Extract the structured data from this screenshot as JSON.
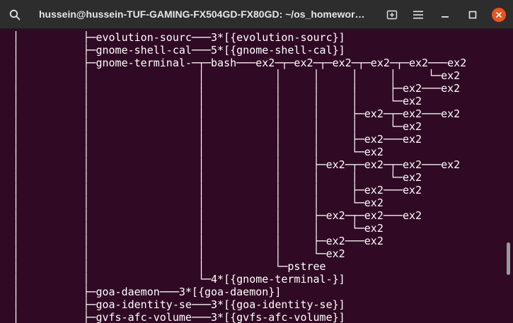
{
  "window": {
    "title": "hussein@hussein-TUF-GAMING-FX504GD-FX80GD: ~/os_homewor…",
    "buttons": {
      "search": "search-icon",
      "new_tab": "new-tab-icon",
      "menu": "hamburger-menu-icon",
      "minimize": "minimize-icon",
      "maximize": "maximize-icon",
      "close": "close-icon"
    },
    "colors": {
      "background": "#300a24",
      "titlebar": "#2d2d2d",
      "text": "#ffffff",
      "close_button": "#e95420"
    }
  },
  "terminal": {
    "lines": [
      "  │          ├─evolution-sourc───3*[{evolution-sourc}]",
      "  │          ├─gnome-shell-cal───5*[{gnome-shell-cal}]",
      "  │          ├─gnome-terminal-─┬─bash───ex2─┬─ex2─┬─ex2─┬─ex2─┬─ex2───ex2",
      "  │          │                 │           │     │     │     │     └─ex2",
      "  │          │                 │           │     │     │     ├─ex2───ex2",
      "  │          │                 │           │     │     │     └─ex2",
      "  │          │                 │           │     │     ├─ex2─┬─ex2───ex2",
      "  │          │                 │           │     │     │     └─ex2",
      "  │          │                 │           │     │     ├─ex2───ex2",
      "  │          │                 │           │     │     └─ex2",
      "  │          │                 │           │     ├─ex2─┬─ex2─┬─ex2───ex2",
      "  │          │                 │           │     │     │     └─ex2",
      "  │          │                 │           │     │     ├─ex2───ex2",
      "  │          │                 │           │     │     └─ex2",
      "  │          │                 │           │     ├─ex2─┬─ex2───ex2",
      "  │          │                 │           │     │     └─ex2",
      "  │          │                 │           │     ├─ex2───ex2",
      "  │          │                 │           │     └─ex2",
      "  │          │                 │           └─pstree",
      "  │          │                 └─4*[{gnome-terminal-}]",
      "  │          ├─goa-daemon───3*[{goa-daemon}]",
      "  │          ├─goa-identity-se───3*[{goa-identity-se}]",
      "  │          ├─gvfs-afc-volume───3*[{gvfs-afc-volume}]"
    ]
  },
  "scrollbar": {
    "position_fraction": 0.72
  }
}
